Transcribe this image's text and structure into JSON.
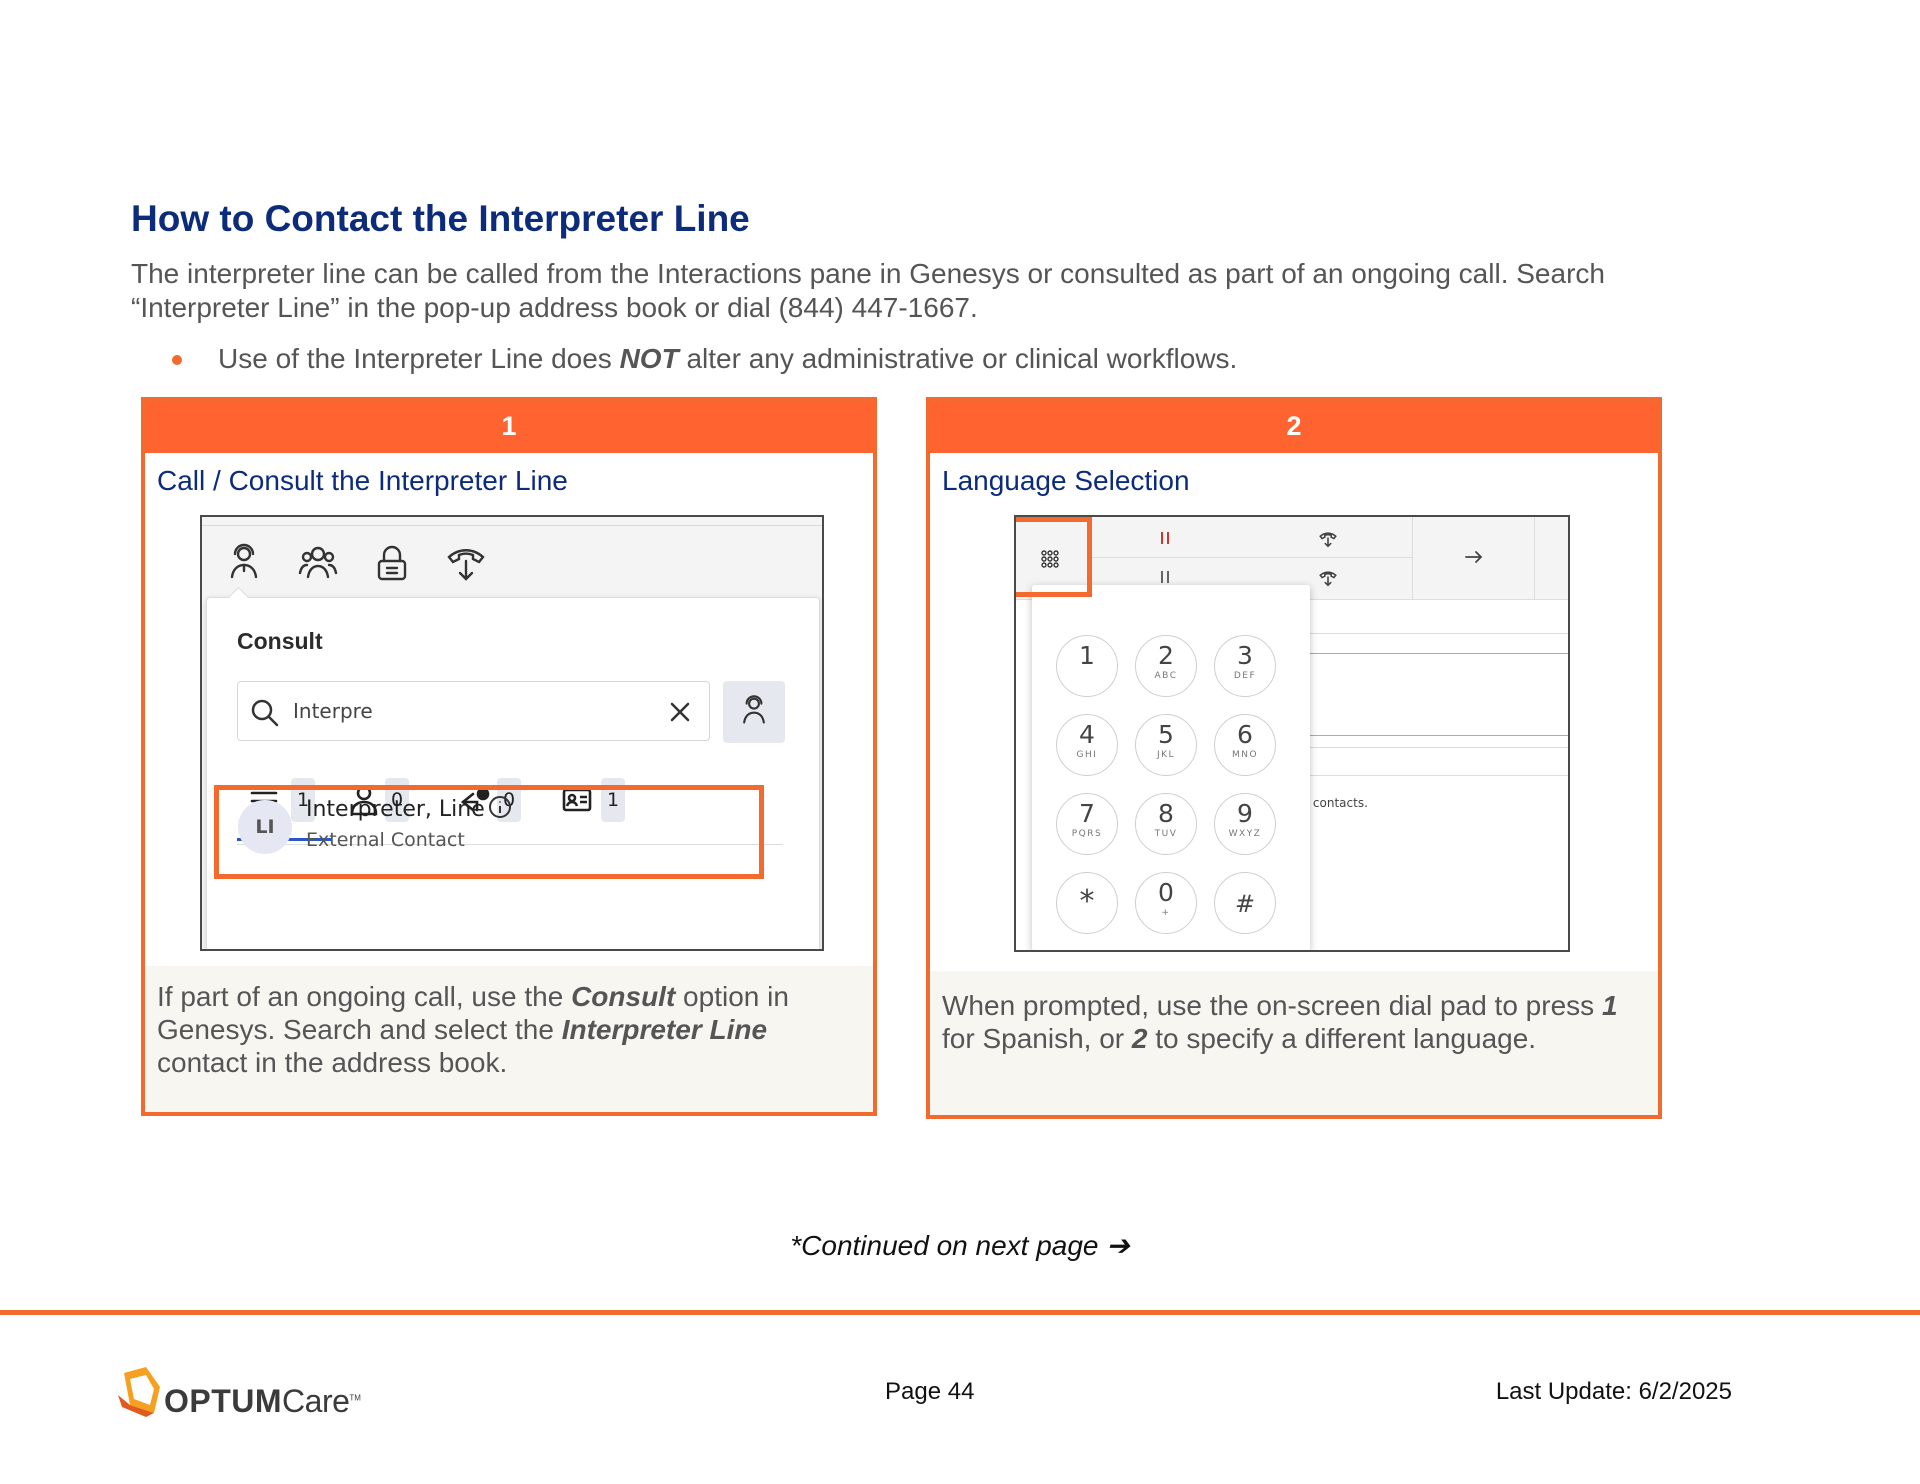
{
  "heading": "How to Contact the Interpreter Line",
  "intro": "The interpreter line can be called from the Interactions pane in Genesys or consulted as part of an ongoing call. Search “Interpreter Line” in the pop-up address book or dial (844) 447-1667.",
  "bullet": {
    "pre": "Use of the Interpreter Line does ",
    "emph": "NOT",
    "post": " alter any administrative or clinical workflows."
  },
  "step1": {
    "number": "1",
    "title": "Call / Consult the Interpreter Line",
    "screenshot": {
      "toolbar_icons": [
        "consult-user-icon",
        "group-icon",
        "secure-lock-icon",
        "transfer-call-icon"
      ],
      "consult_title": "Consult",
      "search_value": "Interpre",
      "tabs": [
        {
          "icon": "list-icon",
          "count": "1"
        },
        {
          "icon": "person-icon",
          "count": "0"
        },
        {
          "icon": "recent-icon",
          "count": "0"
        },
        {
          "icon": "contact-card-icon",
          "count": "1"
        }
      ],
      "result": {
        "initials": "LI",
        "name": "Interpreter, Line",
        "type": "External Contact"
      }
    },
    "desc": {
      "t1": "If part of an ongoing call, use the ",
      "b1": "Consult",
      "t2": " option in Genesys. Search and select the ",
      "b2": "Interpreter Line",
      "t3": " contact in the address book."
    }
  },
  "step2": {
    "number": "2",
    "title": "Language Selection",
    "screenshot": {
      "background_text": "y contacts.",
      "keys": [
        {
          "digit": "1",
          "letters": ""
        },
        {
          "digit": "2",
          "letters": "ABC"
        },
        {
          "digit": "3",
          "letters": "DEF"
        },
        {
          "digit": "4",
          "letters": "GHI"
        },
        {
          "digit": "5",
          "letters": "JKL"
        },
        {
          "digit": "6",
          "letters": "MNO"
        },
        {
          "digit": "7",
          "letters": "PQRS"
        },
        {
          "digit": "8",
          "letters": "TUV"
        },
        {
          "digit": "9",
          "letters": "WXYZ"
        },
        {
          "digit": "*",
          "letters": ""
        },
        {
          "digit": "0",
          "letters": "+"
        },
        {
          "digit": "#",
          "letters": ""
        }
      ]
    },
    "desc": {
      "t1": "When prompted, use the on-screen dial pad to press ",
      "b1": "1",
      "t2": " for Spanish, or ",
      "b2": "2",
      "t3": " to specify a different language."
    }
  },
  "continued": "*Continued on next page ➔",
  "footer": {
    "logo_bold": "OPTUM",
    "logo_light": "Care",
    "logo_tm": "TM",
    "page": "Page 44",
    "last_update": "Last Update: 6/2/2025"
  },
  "colors": {
    "accent": "#f26a2e",
    "header_orange": "#ff6330",
    "title_blue": "#0c2b7a",
    "footer_bg": "#f7f6f1"
  }
}
